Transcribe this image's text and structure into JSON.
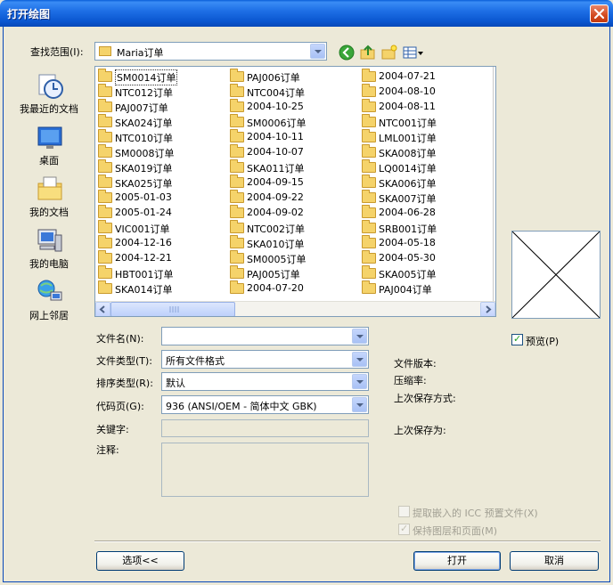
{
  "window": {
    "title": "打开绘图"
  },
  "lookin": {
    "label": "查找范围(I):",
    "value": "Maria订单"
  },
  "places": [
    {
      "label": "我最近的文档",
      "icon": "recent-documents-icon"
    },
    {
      "label": "桌面",
      "icon": "desktop-icon"
    },
    {
      "label": "我的文档",
      "icon": "my-documents-icon"
    },
    {
      "label": "我的电脑",
      "icon": "my-computer-icon"
    },
    {
      "label": "网上邻居",
      "icon": "network-places-icon"
    }
  ],
  "files": {
    "col1": [
      "SM0014订单",
      "NTC012订单",
      "PAJ007订单",
      "SKA024订单",
      "NTC010订单",
      "SM0008订单",
      "SKA019订单",
      "SKA025订单",
      "2005-01-03",
      "2005-01-24",
      "VIC001订单",
      "2004-12-16",
      "2004-12-21",
      "HBT001订单",
      "SKA014订单"
    ],
    "col2": [
      "PAJ006订单",
      "NTC004订单",
      "2004-10-25",
      "SM0006订单",
      "2004-10-11",
      "2004-10-07",
      "SKA011订单",
      "2004-09-15",
      "2004-09-22",
      "2004-09-02",
      "NTC002订单",
      "SKA010订单",
      "SM0005订单",
      "PAJ005订单",
      "2004-07-20"
    ],
    "col3": [
      "2004-07-21",
      "2004-08-10",
      "2004-08-11",
      "NTC001订单",
      "LML001订单",
      "SKA008订单",
      "LQ0014订单",
      "SKA006订单",
      "SKA007订单",
      "2004-06-28",
      "SRB001订单",
      "2004-05-18",
      "2004-05-30",
      "SKA005订单",
      "PAJ004订单"
    ]
  },
  "form": {
    "filename_label": "文件名(N):",
    "filename_value": "",
    "filetype_label": "文件类型(T):",
    "filetype_value": "所有文件格式",
    "sorttype_label": "排序类型(R):",
    "sorttype_value": "默认",
    "codepage_label": "代码页(G):",
    "codepage_value": "936  (ANSI/OEM - 简体中文 GBK)",
    "keywords_label": "关键字:",
    "notes_label": "注释:"
  },
  "info": {
    "preview_label": "预览(P)",
    "file_version": "文件版本:",
    "compression": "压缩率:",
    "last_saved_method": "上次保存方式:",
    "last_saved_as": "上次保存为:"
  },
  "options": {
    "icc_label": "提取嵌入的 ICC 预置文件(X)",
    "layers_label": "保持图层和页面(M)"
  },
  "buttons": {
    "options": "选项<<",
    "open": "打开",
    "cancel": "取消"
  }
}
